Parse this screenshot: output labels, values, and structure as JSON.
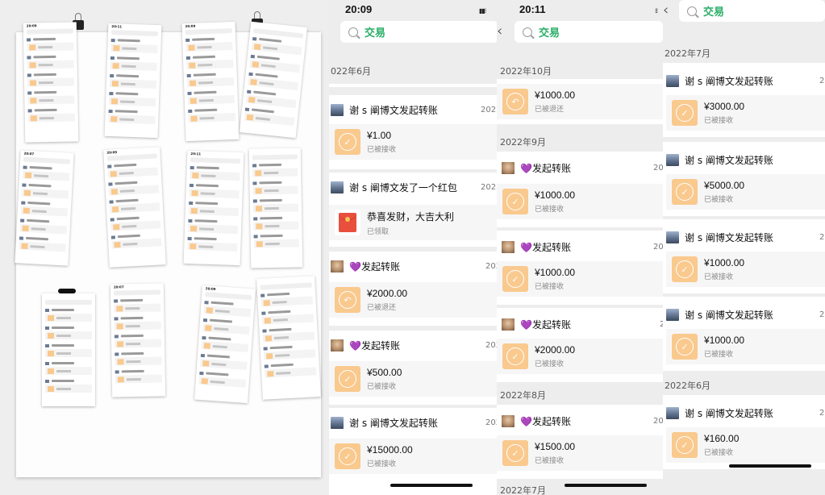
{
  "collage": {
    "mini_times": [
      "20:09",
      "20:11",
      "20:09",
      "20:07",
      "20:09",
      "20:11",
      "20:07",
      "20:09"
    ]
  },
  "screen1": {
    "time": "20:09",
    "search_text": "交易",
    "first_month": "022年6月",
    "entries": [
      {
        "title": "谢 s 阐博文发起转账",
        "date": "2022",
        "amount": "¥1.00",
        "state": "已被接收"
      },
      {
        "title": "谢 s 阐博文发了一个红包",
        "date": "2022",
        "text": "恭喜发财，大吉大利",
        "state": "已领取"
      },
      {
        "title": "💜发起转账",
        "date": "202",
        "amount": "¥2000.00",
        "state": "已被退还"
      },
      {
        "title": "💜发起转账",
        "date": "202",
        "amount": "¥500.00",
        "state": "已被接收"
      },
      {
        "title": "谢 s 阐博文发起转账",
        "date": "202",
        "amount": "¥15000.00",
        "state": "已被接收"
      }
    ]
  },
  "screen2": {
    "time": "20:11",
    "search_text": "交易",
    "months": [
      "2022年10月",
      "2022年9月",
      "2022年8月",
      "2022年7月"
    ],
    "entries": [
      {
        "title": "",
        "date": "",
        "amount": "¥1000.00",
        "state": "已被退还"
      },
      {
        "title": "💜发起转账",
        "date": "20",
        "amount": "¥1000.00",
        "state": "已被接收"
      },
      {
        "title": "💜发起转账",
        "date": "20",
        "amount": "¥1000.00",
        "state": "已被接收"
      },
      {
        "title": "💜发起转账",
        "date": "2",
        "amount": "¥2000.00",
        "state": "已被接收"
      },
      {
        "title": "💜发起转账",
        "date": "20",
        "amount": "¥1500.00",
        "state": "已被接收"
      }
    ]
  },
  "screen3": {
    "search_text": "交易",
    "months": [
      "2022年7月",
      "2022年6月"
    ],
    "entries": [
      {
        "title": "谢 s 阐博文发起转账",
        "date": "20",
        "amount": "¥3000.00",
        "state": "已被接收"
      },
      {
        "title": "谢 s 阐博文发起转账",
        "date": "",
        "amount": "¥5000.00",
        "state": "已被接收"
      },
      {
        "title": "谢 s 阐博文发起转账",
        "date": "20",
        "amount": "¥1000.00",
        "state": "已被接收"
      },
      {
        "title": "谢 s 阐博文发起转账",
        "date": "20",
        "amount": "¥1000.00",
        "state": "已被接收"
      },
      {
        "title": "谢 s 阐博文发起转账",
        "date": "20",
        "amount": "¥160.00",
        "state": "已被接收"
      }
    ]
  },
  "icons": {
    "search": "search-icon",
    "back": "back-arrow-icon",
    "accepted": "check-circle-icon",
    "returned": "return-arrow-icon",
    "red_packet": "red-envelope-icon"
  },
  "colors": {
    "accent_green": "#2aae67",
    "transfer_orange": "#f9c98e",
    "red_packet": "#e94f3d",
    "heart_purple": "#9b4fd9",
    "background": "#ededed"
  }
}
